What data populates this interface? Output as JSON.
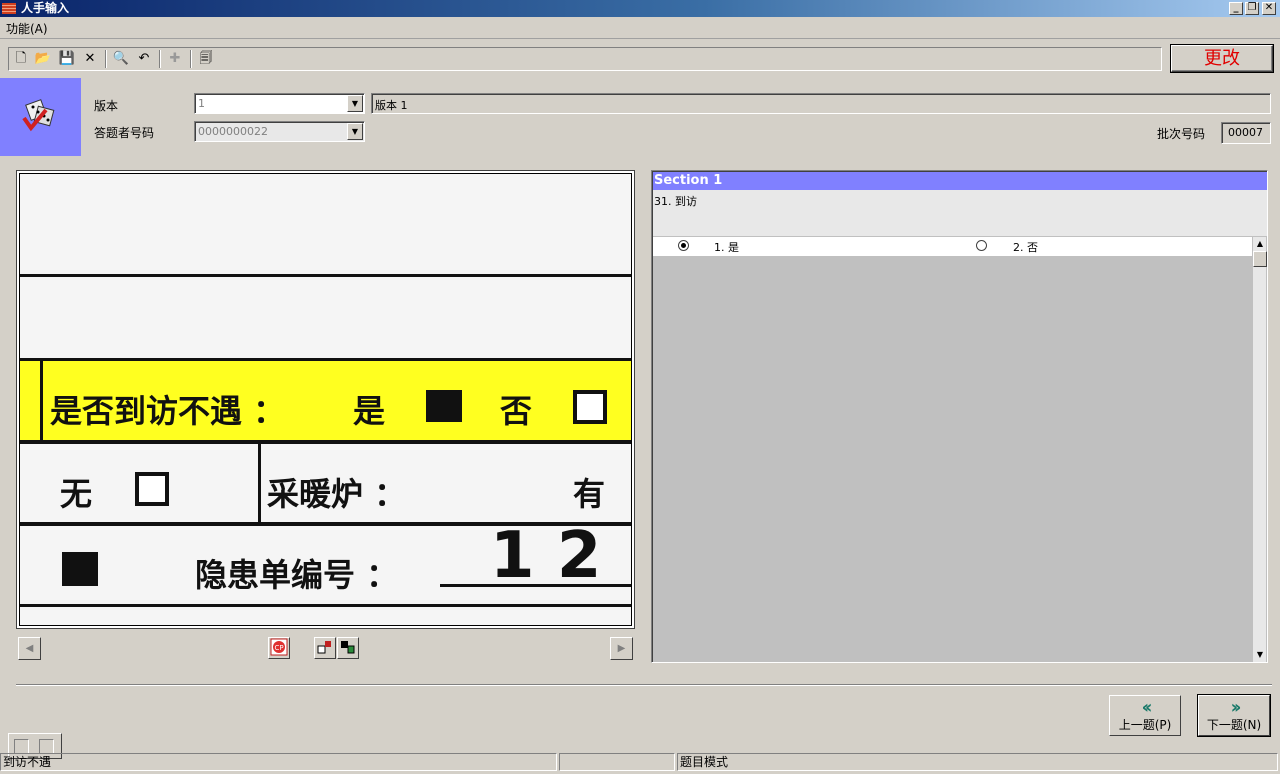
{
  "window": {
    "title": "人手输入",
    "min": "_",
    "restore": "❐",
    "close": "✕"
  },
  "menu": {
    "func": "功能(A)"
  },
  "toolbar": {
    "new_icon": "🗋",
    "open_icon": "📂",
    "save_icon": "💾",
    "delete_icon": "✕",
    "find_icon": "🔍",
    "undo_icon": "↶",
    "add_icon": "✚",
    "preview_icon": "🗐"
  },
  "change_button": "更改",
  "form": {
    "version_label": "版本",
    "version_value": "1",
    "version_desc": "版本 1",
    "respondent_label": "答题者号码",
    "respondent_value": "0000000022",
    "batch_label": "批次号码",
    "batch_value": "00007"
  },
  "scan": {
    "row1": "是否到访不遇 ：",
    "yes": "是",
    "no": "否",
    "row2_left": "无",
    "row2_mid": "采暖炉 ：",
    "row2_right": "有",
    "row3": "隐患单编号 ：",
    "hand": "1 2"
  },
  "question": {
    "section": "Section 1",
    "text": "31. 到访",
    "options": [
      {
        "label": "1. 是",
        "selected": true
      },
      {
        "label": "2. 否",
        "selected": false
      }
    ]
  },
  "nav": {
    "prev_label": "上一题(P)",
    "next_label": "下一题(N)",
    "prev_icon": "‹‹",
    "next_icon": "››"
  },
  "status": {
    "left": "到访不遇",
    "mode": "题目模式"
  },
  "colors": {
    "section_header": "#8080ff",
    "change_text": "#e00000",
    "nav_chevron": "#1a7a6a",
    "highlight": "#ffff20"
  }
}
